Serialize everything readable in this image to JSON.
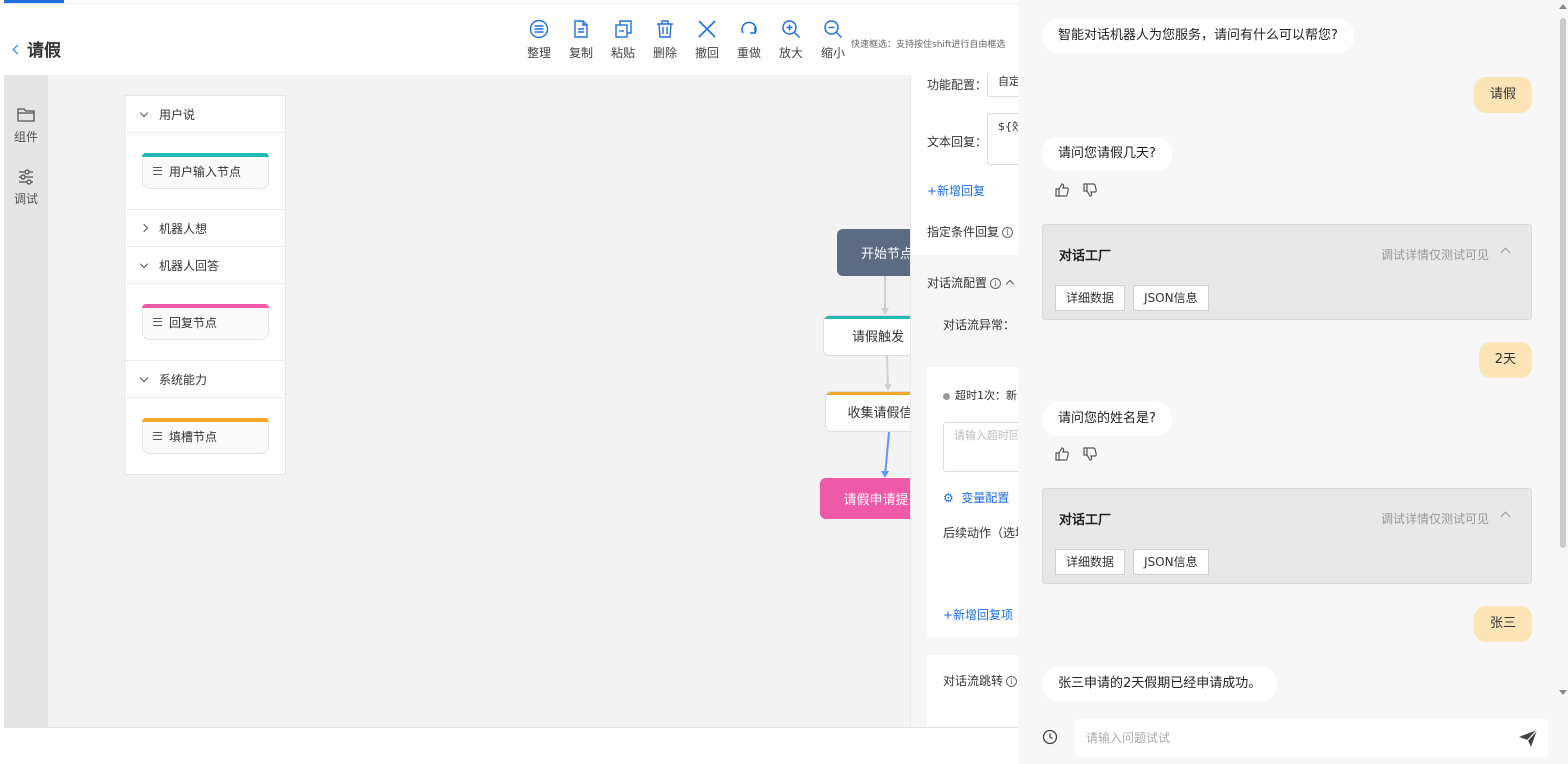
{
  "header": {
    "title": "请假",
    "tip": "快速框选：支持按住shift进行自由框选"
  },
  "toolbar": [
    {
      "label": "整理",
      "icon": "arrange-icon"
    },
    {
      "label": "复制",
      "icon": "copy-icon"
    },
    {
      "label": "粘贴",
      "icon": "paste-icon"
    },
    {
      "label": "删除",
      "icon": "delete-icon"
    },
    {
      "label": "撤回",
      "icon": "undo-icon"
    },
    {
      "label": "重做",
      "icon": "redo-icon"
    },
    {
      "label": "放大",
      "icon": "zoom-in-icon"
    },
    {
      "label": "缩小",
      "icon": "zoom-out-icon"
    }
  ],
  "leftbar": [
    {
      "label": "组件",
      "icon": "folder-icon"
    },
    {
      "label": "调试",
      "icon": "sliders-icon"
    }
  ],
  "components": {
    "sections": [
      {
        "title": "用户说",
        "expanded": true,
        "item": "用户输入节点",
        "color": "#23b7b5"
      },
      {
        "title": "机器人想",
        "expanded": false
      },
      {
        "title": "机器人回答",
        "expanded": true,
        "item": "回复节点",
        "color": "#ef5aa8"
      },
      {
        "title": "系统能力",
        "expanded": true,
        "item": "填槽节点",
        "color": "#f4a62a"
      }
    ]
  },
  "flow": {
    "start": "开始节点",
    "trigger": "请假触发",
    "collect": "收集请假信",
    "submit": "请假申请提"
  },
  "config": {
    "func_label": "功能配置：",
    "func_value": "自定",
    "text_reply_label": "文本回复：",
    "text_reply_value": "${效",
    "add_reply": "+新增回复",
    "cond_reply": "指定条件回复",
    "flow_config": "对话流配置",
    "flow_error": "对话流异常：",
    "timeout": "超时1次：",
    "timeout_suffix": "新",
    "timeout_placeholder": "请输入超时回",
    "var_config": "变量配置",
    "followup": "后续动作（选填",
    "add_reply_item": "+新增回复项",
    "flow_jump": "对话流跳转"
  },
  "chat": {
    "messages": [
      {
        "role": "bot",
        "text": "智能对话机器人为您服务，请问有什么可以帮您?"
      },
      {
        "role": "user",
        "text": "请假"
      },
      {
        "role": "bot",
        "text": "请问您请假几天?",
        "feedback": true
      },
      {
        "role": "debug",
        "title": "对话工厂",
        "note": "调试详情仅测试可见",
        "buttons": [
          "详细数据",
          "JSON信息"
        ]
      },
      {
        "role": "user",
        "text": "2天"
      },
      {
        "role": "bot",
        "text": "请问您的姓名是?",
        "feedback": true
      },
      {
        "role": "debug",
        "title": "对话工厂",
        "note": "调试详情仅测试可见",
        "buttons": [
          "详细数据",
          "JSON信息"
        ]
      },
      {
        "role": "user",
        "text": "张三"
      },
      {
        "role": "bot",
        "text": "张三申请的2天假期已经申请成功。"
      }
    ],
    "input_placeholder": "请输入问题试试"
  }
}
